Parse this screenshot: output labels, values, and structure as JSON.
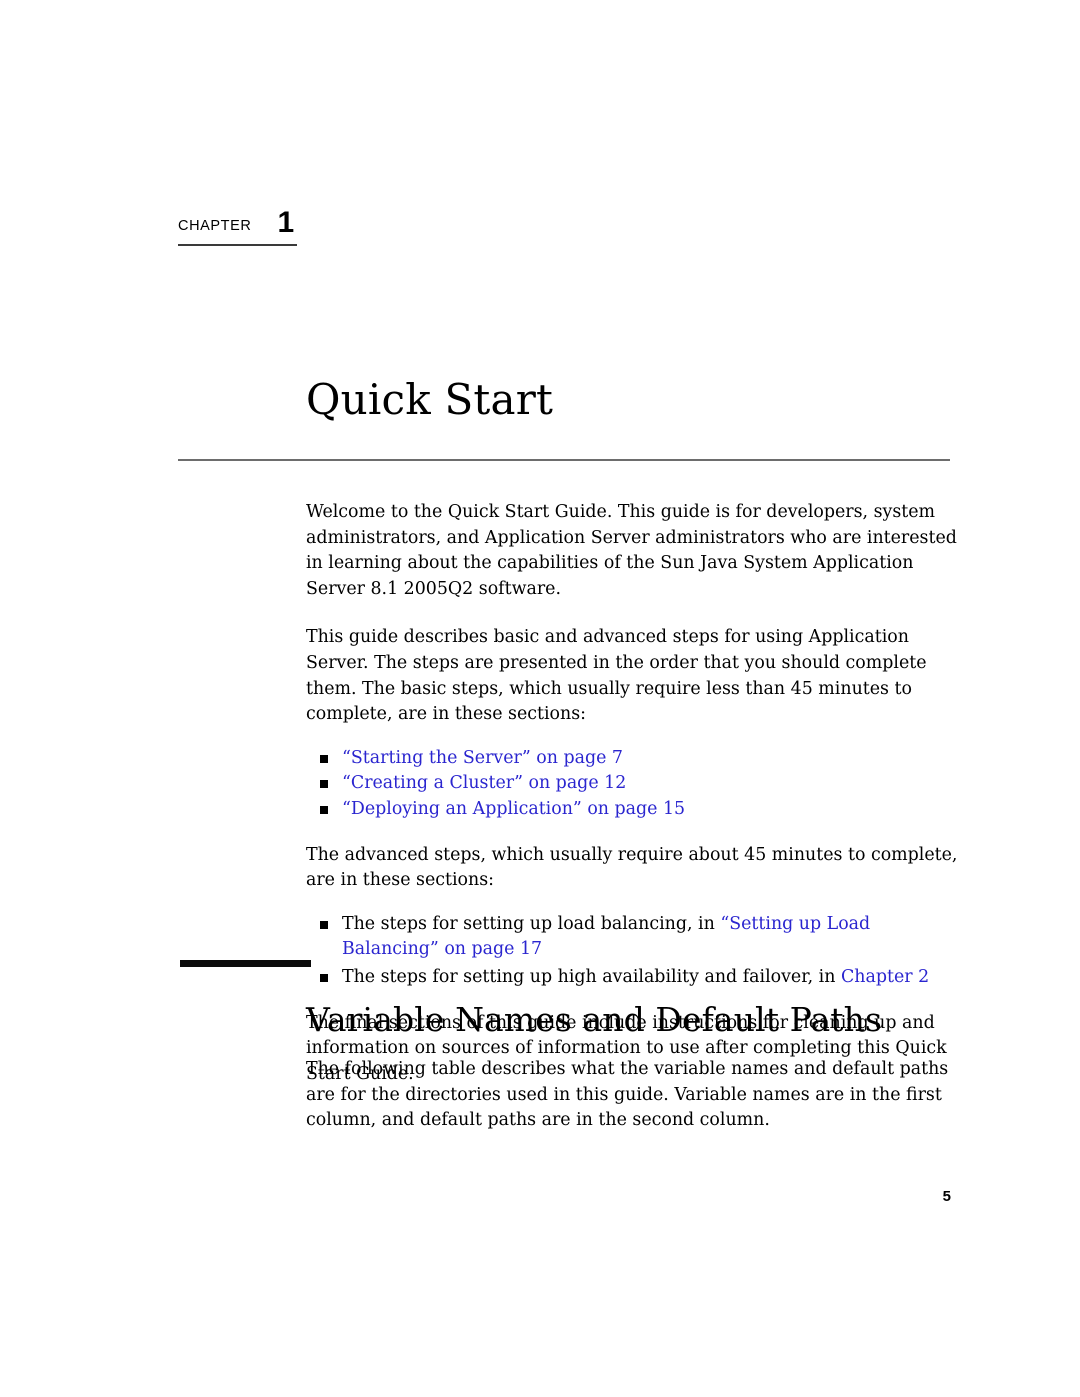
{
  "document": {
    "chapter_label": "CHAPTER",
    "chapter_number": "1",
    "chapter_title": "Quick Start",
    "page_number": "5",
    "link_color": "#2a25cf",
    "rule_color": "#6d6d6d",
    "bar_color": "#0b0b0b"
  },
  "intro": {
    "paragraph_1": "Welcome to the Quick Start Guide. This guide is for developers, system administrators, and Application Server administrators who are interested in learning about the capabilities of the Sun Java System Application Server 8.1 2005Q2 software.",
    "paragraph_2": "This guide describes basic and advanced steps for using Application Server. The steps are presented in the order that you should complete them. The basic steps, which usually require less than 45 minutes to complete, are in these sections:",
    "paragraph_3": "The advanced steps, which usually require about 45 minutes to complete, are in these sections:",
    "paragraph_4": "The final sections of this guide include instructions for cleaning up and information on sources of information to use after completing this Quick Start Guide."
  },
  "basic_steps_list": [
    {
      "link_text": "“Starting the Server” on page 7"
    },
    {
      "link_text": "“Creating a Cluster” on page 12"
    },
    {
      "link_text": "“Deploying an Application” on page 15"
    }
  ],
  "advanced_steps_list": [
    {
      "lead_text": "The steps for setting up load balancing, in ",
      "link_text": "“Setting up Load Balancing” on page 17",
      "trail_text": ""
    },
    {
      "lead_text": "The steps for setting up high availability and failover, in ",
      "link_text": "Chapter 2",
      "trail_text": ""
    }
  ],
  "section": {
    "heading": "Variable Names and Default Paths",
    "paragraph": "The following table describes what the variable names and default paths are for the directories used in this guide. Variable names are in the first column, and default paths are in the second column."
  }
}
